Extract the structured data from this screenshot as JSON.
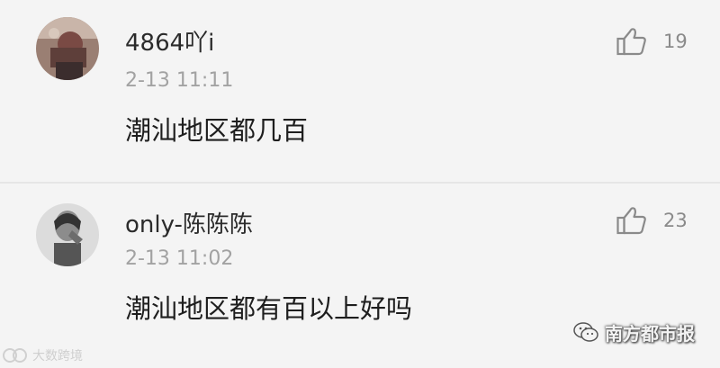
{
  "comments": [
    {
      "username": "4864吖i",
      "timestamp": "2-13 11:11",
      "content": "潮汕地区都几百",
      "likes": "19",
      "avatar_icon": "user-avatar-photo"
    },
    {
      "username": "only-陈陈陈",
      "timestamp": "2-13 11:02",
      "content": "潮汕地区都有百以上好吗",
      "likes": "23",
      "avatar_icon": "user-avatar-photo"
    }
  ],
  "watermarks": {
    "left": "大数跨境",
    "right": "南方都市报"
  },
  "icons": {
    "like": "thumbs-up-icon",
    "right_watermark": "wechat-logo-icon"
  },
  "colors": {
    "background": "#f4f4f4",
    "username": "#2b2b2b",
    "timestamp": "#a2a2a2",
    "content": "#1e1e1e",
    "like_icon": "#8a8a8a"
  }
}
